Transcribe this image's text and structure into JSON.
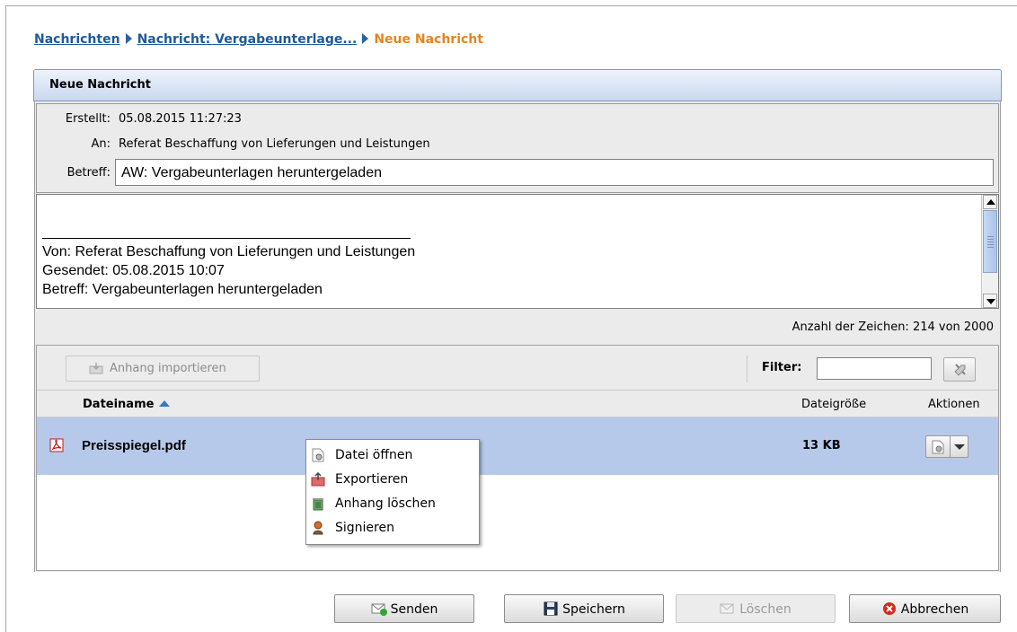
{
  "breadcrumb": {
    "items": [
      "Nachrichten",
      "Nachricht: Vergabeunterlage..."
    ],
    "current": "Neue Nachricht"
  },
  "panel": {
    "title": "Neue Nachricht"
  },
  "meta": {
    "created_label": "Erstellt:",
    "created_value": "05.08.2015 11:27:23",
    "to_label": "An:",
    "to_value": "Referat Beschaffung von Lieferungen und Leistungen",
    "subject_label": "Betreff:",
    "subject_value": "AW: Vergabeunterlagen heruntergeladen"
  },
  "body": {
    "lines": [
      "Von: Referat Beschaffung von Lieferungen und Leistungen",
      "Gesendet: 05.08.2015 10:07",
      "Betreff: Vergabeunterlagen heruntergeladen"
    ]
  },
  "char_count": "Anzahl der Zeichen: 214 von 2000",
  "attachments": {
    "import_button": "Anhang importieren",
    "filter_label": "Filter:",
    "filter_value": "",
    "columns": {
      "name": "Dateiname",
      "size": "Dateigröße",
      "actions": "Aktionen"
    },
    "rows": [
      {
        "name": "Preisspiegel.pdf",
        "size": "13 KB"
      }
    ]
  },
  "context_menu": {
    "items": [
      {
        "label": "Datei öffnen",
        "icon": "file-open-icon"
      },
      {
        "label": "Exportieren",
        "icon": "export-icon"
      },
      {
        "label": "Anhang löschen",
        "icon": "trash-icon"
      },
      {
        "label": "Signieren",
        "icon": "signature-icon"
      }
    ]
  },
  "footer": {
    "send": "Senden",
    "save": "Speichern",
    "delete": "Löschen",
    "cancel": "Abbrechen"
  },
  "colors": {
    "link": "#1e5a9c",
    "current_crumb": "#e8831e",
    "selected_row": "#b6c9ea",
    "panel_header": "#c9d8ef"
  }
}
